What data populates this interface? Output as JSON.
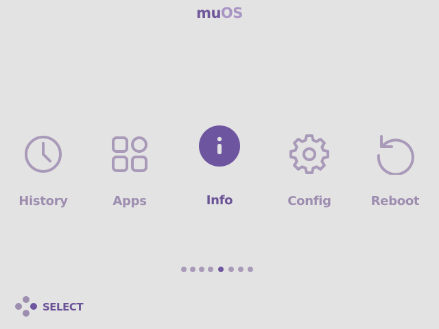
{
  "header": {
    "title_prefix": "mu",
    "title_suffix": "OS"
  },
  "menu": {
    "items": [
      {
        "label": "History",
        "icon": "clock-icon",
        "selected": false
      },
      {
        "label": "Apps",
        "icon": "grid-icon",
        "selected": false
      },
      {
        "label": "Info",
        "icon": "info-icon",
        "selected": true
      },
      {
        "label": "Config",
        "icon": "gear-icon",
        "selected": false
      },
      {
        "label": "Reboot",
        "icon": "restart-icon",
        "selected": false
      }
    ]
  },
  "pager": {
    "total": 8,
    "active_index": 4
  },
  "footer": {
    "select_label": "SELECT",
    "icon": "dpad-icon"
  },
  "colors": {
    "background": "#e4e3e4",
    "accent": "#6d55a0",
    "muted": "#a89ab8"
  }
}
